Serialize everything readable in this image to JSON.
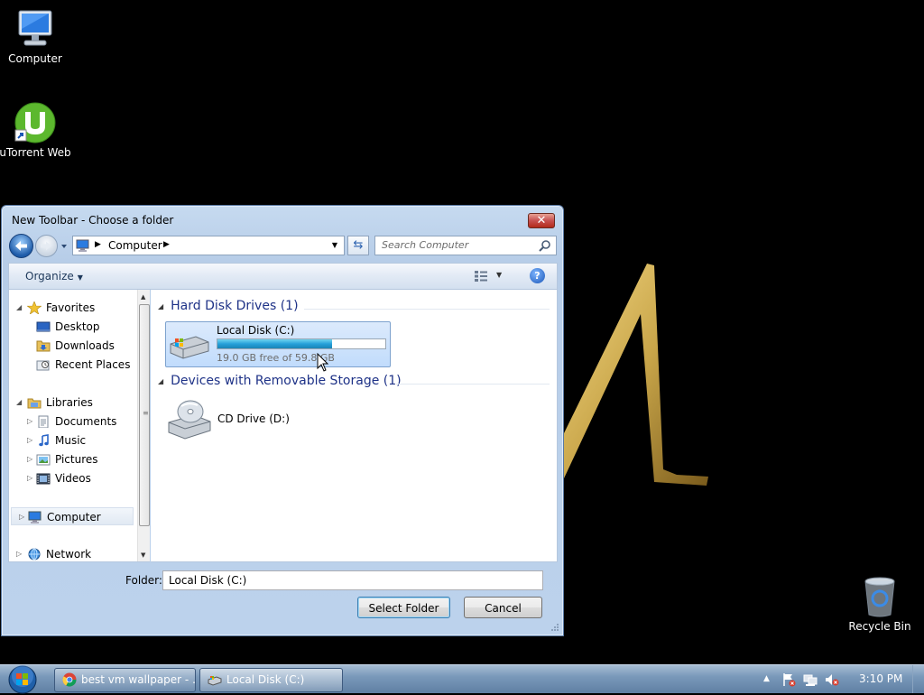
{
  "desktop": {
    "icons": [
      {
        "label": "Computer",
        "icon": "computer-icon"
      },
      {
        "label": "uTorrent Web",
        "icon": "utorrent-icon"
      },
      {
        "label": "Recycle Bin",
        "icon": "recycle-bin-icon"
      }
    ]
  },
  "dialog": {
    "title": "New Toolbar - Choose a folder",
    "close_label": "✕",
    "address": {
      "path": "Computer",
      "icon": "computer-icon"
    },
    "search_placeholder": "Search Computer",
    "toolbar": {
      "organize_label": "Organize",
      "help_label": "?"
    },
    "nav_tree": [
      {
        "label": "Favorites",
        "icon": "star-icon",
        "level": 0,
        "expander": "expanded"
      },
      {
        "label": "Desktop",
        "icon": "desktop-icon",
        "level": 1
      },
      {
        "label": "Downloads",
        "icon": "downloads-folder-icon",
        "level": 1
      },
      {
        "label": "Recent Places",
        "icon": "recent-places-icon",
        "level": 1
      },
      {
        "label": "Libraries",
        "icon": "libraries-icon",
        "level": 0,
        "expander": "expanded"
      },
      {
        "label": "Documents",
        "icon": "documents-icon",
        "level": 1,
        "expander": "collapsed"
      },
      {
        "label": "Music",
        "icon": "music-icon",
        "level": 1,
        "expander": "collapsed"
      },
      {
        "label": "Pictures",
        "icon": "pictures-icon",
        "level": 1,
        "expander": "collapsed"
      },
      {
        "label": "Videos",
        "icon": "videos-icon",
        "level": 1,
        "expander": "collapsed"
      },
      {
        "label": "Computer",
        "icon": "computer-icon",
        "level": 0,
        "expander": "collapsed",
        "selected": true
      },
      {
        "label": "Network",
        "icon": "network-icon",
        "level": 0,
        "expander": "collapsed"
      }
    ],
    "groups": {
      "hard_disk": {
        "header": "Hard Disk Drives (1)"
      },
      "removable": {
        "header": "Devices with Removable Storage (1)"
      }
    },
    "drives": {
      "local": {
        "name": "Local Disk (C:)",
        "free_text": "19.0 GB free of 59.8 GB",
        "used_fraction": 0.682,
        "icon": "hard-drive-icon"
      },
      "cd": {
        "name": "CD Drive (D:)",
        "icon": "cd-drive-icon"
      }
    },
    "folder_label": "Folder:",
    "folder_value": "Local Disk (C:)",
    "select_button": "Select Folder",
    "cancel_button": "Cancel"
  },
  "taskbar": {
    "buttons": [
      {
        "label": "best vm wallpaper - ...",
        "icon": "chrome-icon"
      },
      {
        "label": "Local Disk (C:)",
        "icon": "hard-drive-icon",
        "active": true
      }
    ],
    "tray_icons": [
      "action-center-icon",
      "network-tray-icon",
      "volume-muted-icon"
    ],
    "clock": "3:10 PM"
  },
  "colors": {
    "desktop_bg": "#000000",
    "wallpaper_gold": "#c9a64a",
    "selection_blue": "#c1dcfc",
    "group_header": "#1e3287"
  }
}
